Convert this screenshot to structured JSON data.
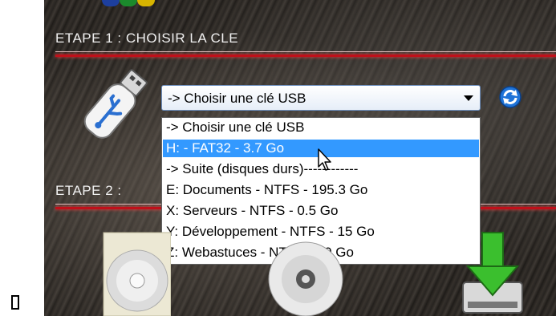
{
  "steps": [
    {
      "title": "ETAPE 1 : CHOISIR LA CLE"
    },
    {
      "title": "ETAPE 2 :"
    }
  ],
  "usb_select": {
    "value": "-> Choisir une clé USB",
    "options": [
      "-> Choisir une clé USB",
      "H:  - FAT32 - 3.7 Go",
      "-> Suite (disques durs)------------",
      "E: Documents - NTFS - 195.3 Go",
      "X: Serveurs - NTFS - 0.5 Go",
      "Y: Développement - NTFS - 15 Go",
      "Z: Webastuces - NTFS - 40 Go"
    ],
    "highlighted_index": 1
  },
  "icons": {
    "usb": "usb-key-icon",
    "refresh": "refresh-icon",
    "cd_left": "cd-disc-icon",
    "cd_center": "cd-disc-icon",
    "drive": "download-drive-icon",
    "cursor": "mouse-cursor-icon",
    "missing_glyph": "missing-glyph"
  },
  "colors": {
    "highlight": "#3399ff",
    "accent_line": "#c0101a",
    "combo_border": "#6d8fbf"
  }
}
